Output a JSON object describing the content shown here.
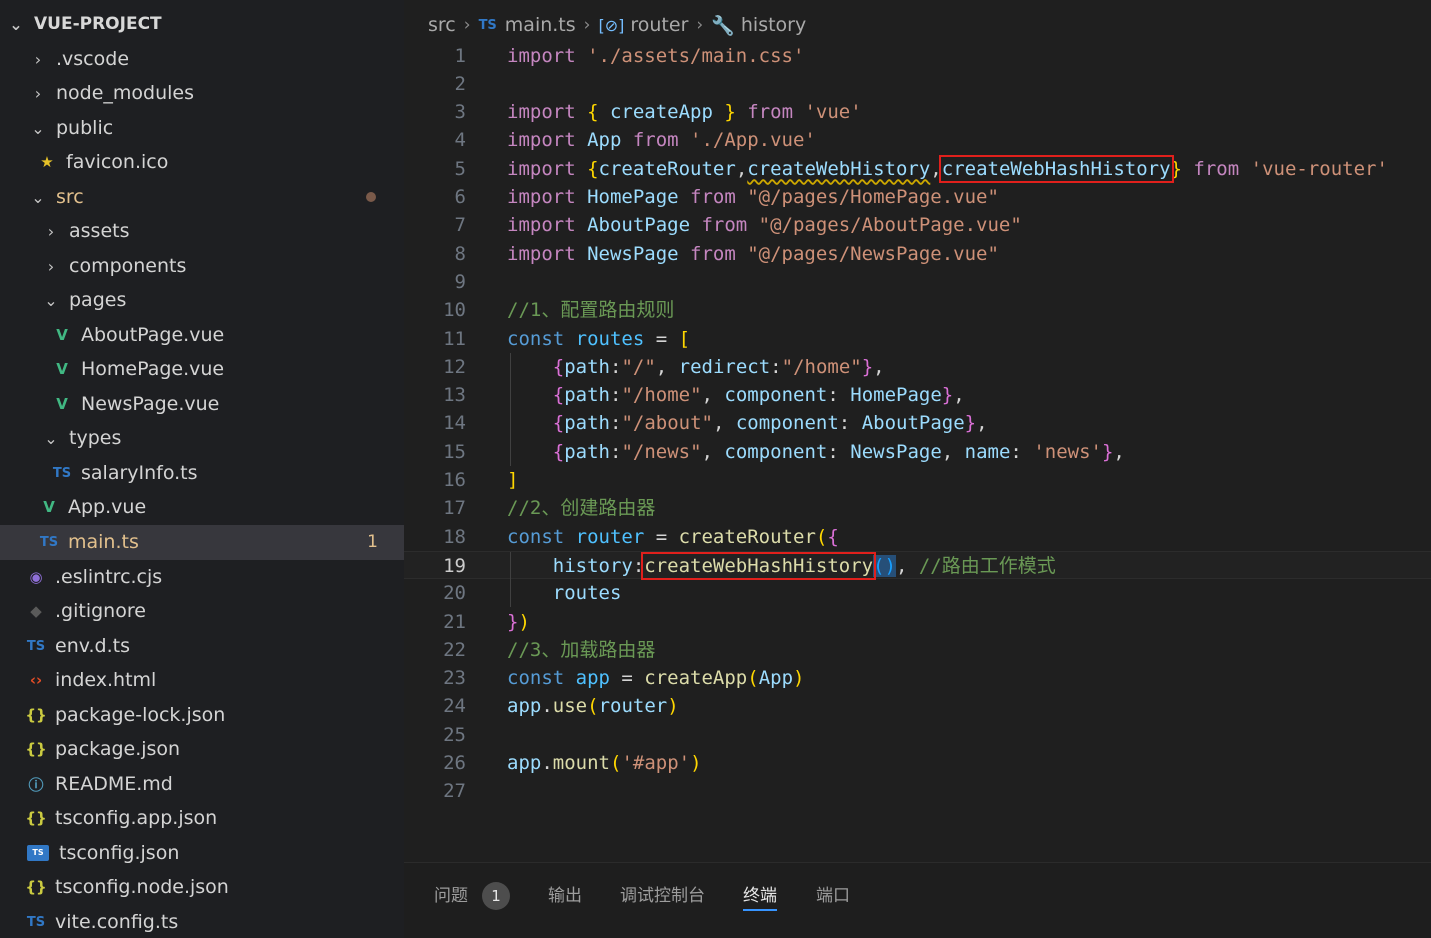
{
  "explorer": {
    "root": "VUE-PROJECT",
    "items": [
      {
        "label": ".vscode"
      },
      {
        "label": "node_modules"
      },
      {
        "label": "public"
      },
      {
        "label": "favicon.ico"
      },
      {
        "label": "src"
      },
      {
        "label": "assets"
      },
      {
        "label": "components"
      },
      {
        "label": "pages"
      },
      {
        "label": "AboutPage.vue"
      },
      {
        "label": "HomePage.vue"
      },
      {
        "label": "NewsPage.vue"
      },
      {
        "label": "types"
      },
      {
        "label": "salaryInfo.ts"
      },
      {
        "label": "App.vue"
      },
      {
        "label": "main.ts",
        "badge": "1"
      },
      {
        "label": ".eslintrc.cjs"
      },
      {
        "label": ".gitignore"
      },
      {
        "label": "env.d.ts"
      },
      {
        "label": "index.html"
      },
      {
        "label": "package-lock.json"
      },
      {
        "label": "package.json"
      },
      {
        "label": "README.md"
      },
      {
        "label": "tsconfig.app.json"
      },
      {
        "label": "tsconfig.json"
      },
      {
        "label": "tsconfig.node.json"
      },
      {
        "label": "vite.config.ts"
      }
    ]
  },
  "breadcrumb": {
    "folder": "src",
    "file_type": "TS",
    "file": "main.ts",
    "symbol": "router",
    "property": "history"
  },
  "editor": {
    "current_line": 19,
    "lines": [
      {
        "n": "1",
        "t": [
          "import ",
          "'./assets/main.css'"
        ]
      },
      {
        "n": "2",
        "t": []
      },
      {
        "n": "3",
        "t": [
          "import ",
          "{ ",
          "createApp",
          " } ",
          "from ",
          "'vue'"
        ]
      },
      {
        "n": "4",
        "t": [
          "import ",
          "App ",
          "from ",
          "'./App.vue'"
        ]
      },
      {
        "n": "5",
        "t": [
          "import ",
          "{",
          "createRouter",
          ",",
          "createWebHistory",
          ",",
          "createWebHashHistory",
          "}",
          " from ",
          "'vue-router'"
        ]
      },
      {
        "n": "6",
        "t": [
          "import ",
          "HomePage ",
          "from ",
          "\"@/pages/HomePage.vue\""
        ]
      },
      {
        "n": "7",
        "t": [
          "import ",
          "AboutPage ",
          "from ",
          "\"@/pages/AboutPage.vue\""
        ]
      },
      {
        "n": "8",
        "t": [
          "import ",
          "NewsPage ",
          "from ",
          "\"@/pages/NewsPage.vue\""
        ]
      },
      {
        "n": "9",
        "t": []
      },
      {
        "n": "10",
        "t": [
          "//1、配置路由规则"
        ]
      },
      {
        "n": "11",
        "t": [
          "const ",
          "routes ",
          "= ",
          "["
        ]
      },
      {
        "n": "12",
        "t": [
          "    ",
          "{",
          "path",
          ":",
          "\"/\"",
          ", ",
          "redirect",
          ":",
          "\"/home\"",
          "}",
          ","
        ]
      },
      {
        "n": "13",
        "t": [
          "    ",
          "{",
          "path",
          ":",
          "\"/home\"",
          ", ",
          "component",
          ": ",
          "HomePage",
          "}",
          ","
        ]
      },
      {
        "n": "14",
        "t": [
          "    ",
          "{",
          "path",
          ":",
          "\"/about\"",
          ", ",
          "component",
          ": ",
          "AboutPage",
          "}",
          ","
        ]
      },
      {
        "n": "15",
        "t": [
          "    ",
          "{",
          "path",
          ":",
          "\"/news\"",
          ", ",
          "component",
          ": ",
          "NewsPage",
          ", ",
          "name",
          ": ",
          "'news'",
          "}",
          ","
        ]
      },
      {
        "n": "16",
        "t": [
          "]"
        ]
      },
      {
        "n": "17",
        "t": [
          "//2、创建路由器"
        ]
      },
      {
        "n": "18",
        "t": [
          "const ",
          "router ",
          "= ",
          "createRouter",
          "(",
          "{"
        ]
      },
      {
        "n": "19",
        "t": [
          "    ",
          "history",
          ":",
          "createWebHashHistory",
          "()",
          ", ",
          "//路由工作模式"
        ]
      },
      {
        "n": "20",
        "t": [
          "    ",
          "routes"
        ]
      },
      {
        "n": "21",
        "t": [
          "}",
          ")"
        ]
      },
      {
        "n": "22",
        "t": [
          "//3、加载路由器"
        ]
      },
      {
        "n": "23",
        "t": [
          "const ",
          "app ",
          "= ",
          "createApp",
          "(",
          "App",
          ")"
        ]
      },
      {
        "n": "24",
        "t": [
          "app",
          ".",
          "use",
          "(",
          "router",
          ")"
        ]
      },
      {
        "n": "25",
        "t": []
      },
      {
        "n": "26",
        "t": [
          "app",
          ".",
          "mount",
          "(",
          "'#app'",
          ")"
        ]
      },
      {
        "n": "27",
        "t": []
      }
    ]
  },
  "panel": {
    "tabs": [
      {
        "label": "问题",
        "count": "1"
      },
      {
        "label": "输出"
      },
      {
        "label": "调试控制台"
      },
      {
        "label": "终端"
      },
      {
        "label": "端口"
      }
    ]
  },
  "colors": {
    "keyword": "#c586c0",
    "string": "#ce9178",
    "comment": "#6a9955",
    "highlight_box": "#e0201c",
    "active_tab_underline": "#3794ff"
  }
}
